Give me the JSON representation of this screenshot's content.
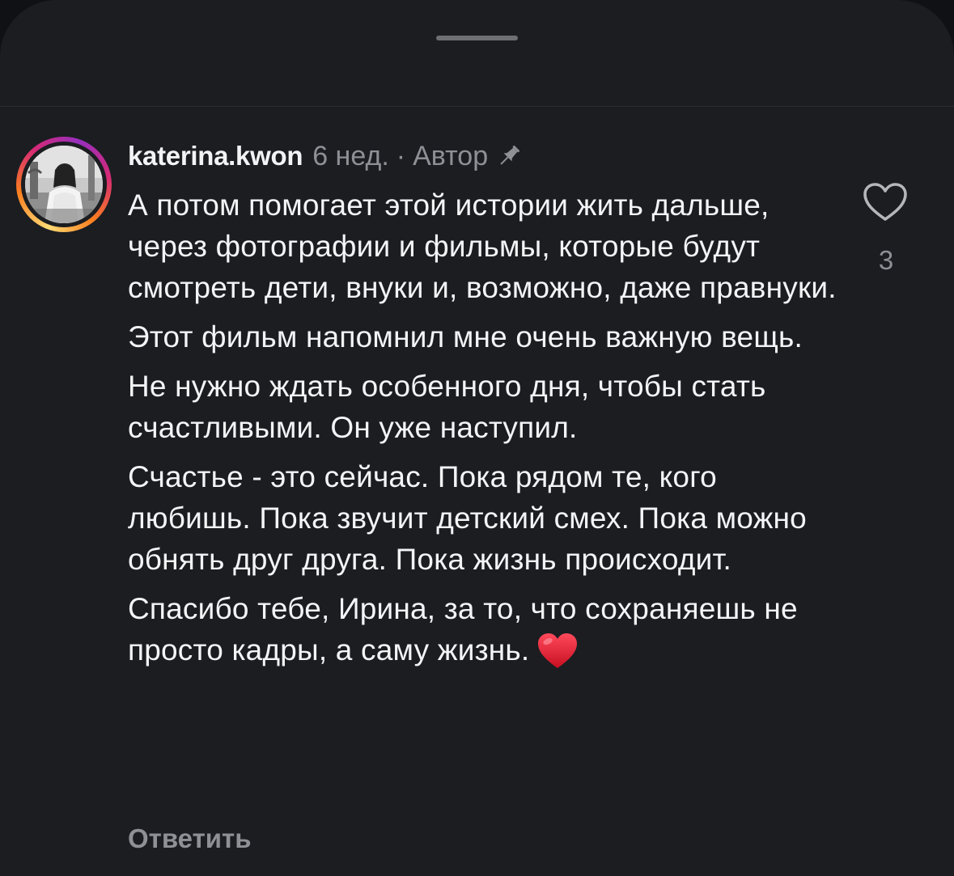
{
  "comment": {
    "username": "katerina.kwon",
    "time_ago": "6 нед.",
    "separator": "·",
    "author_badge": "Автор",
    "pin_icon": "pin-icon",
    "paragraphs": [
      "А потом помогает этой истории жить дальше, через фотографии и фильмы, которые будут смотреть дети, внуки и, возможно, даже правнуки.",
      "Этот фильм напомнил мне очень важную вещь.",
      "Не нужно ждать особенного дня, чтобы стать счастливыми. Он уже наступил.",
      "Счастье - это сейчас. Пока рядом те, кого любишь. Пока звучит детский смех. Пока можно обнять друг друга. Пока жизнь происходит.",
      "Спасибо тебе, Ирина, за то, что сохраняешь не просто кадры, а саму жизнь."
    ],
    "trailing_emoji": "red-heart-emoji",
    "like_icon": "heart-outline-icon",
    "like_count": "3",
    "reply_label": "Ответить"
  },
  "colors": {
    "sheet_background": "#1b1d21",
    "primary_text": "#f3f4f6",
    "secondary_text": "#8e9095",
    "heart_emoji": "#e0142a"
  }
}
